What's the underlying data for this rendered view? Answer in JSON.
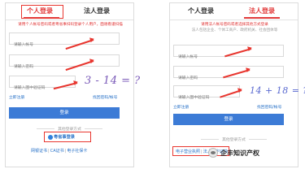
{
  "left": {
    "tabs": {
      "personal": "个人登录",
      "legal": "法人登录"
    },
    "notice": "请用个人帐号密码或者粤省事扫码登录个人用户，面谢看谨扫描",
    "placeholders": {
      "username": "请输入帐号",
      "password": "请输入密码",
      "captcha": "请输入图中验证码"
    },
    "captcha_text": "3 - 14 = ?",
    "links": {
      "register": "立即注册",
      "forgot": "找回密码/帐号"
    },
    "login_button": "登录",
    "other_login_title": "其他登录方式",
    "ygs_label": "粤省事登录",
    "alt_methods": [
      "网银证书",
      "CA证书",
      "电子社保卡"
    ],
    "separator": "|"
  },
  "right": {
    "tabs": {
      "personal": "个人登录",
      "legal": "法人登录"
    },
    "notice": "请用法人帐号密码或者选择其他方式登录",
    "subnotice": "法人包括企业、个体工商户、政府机关、社会团体等",
    "placeholders": {
      "username": "请输入帐号",
      "password": "请输入密码",
      "captcha": "请输入图中验证码"
    },
    "captcha_text": "14 + 18 = ?",
    "links": {
      "register": "立即注册",
      "forgot": "找回密码/帐号"
    },
    "login_button": "登录",
    "other_login_title": "其他登录方式",
    "alt_methods": [
      "电子营业执照",
      "法人数字证书"
    ],
    "separator": "|"
  },
  "watermark": "企丰知识产权",
  "colors": {
    "accent": "#e23a3a",
    "link": "#2a73c8",
    "button": "#3c7bd6",
    "highlight": "#e8362f"
  }
}
